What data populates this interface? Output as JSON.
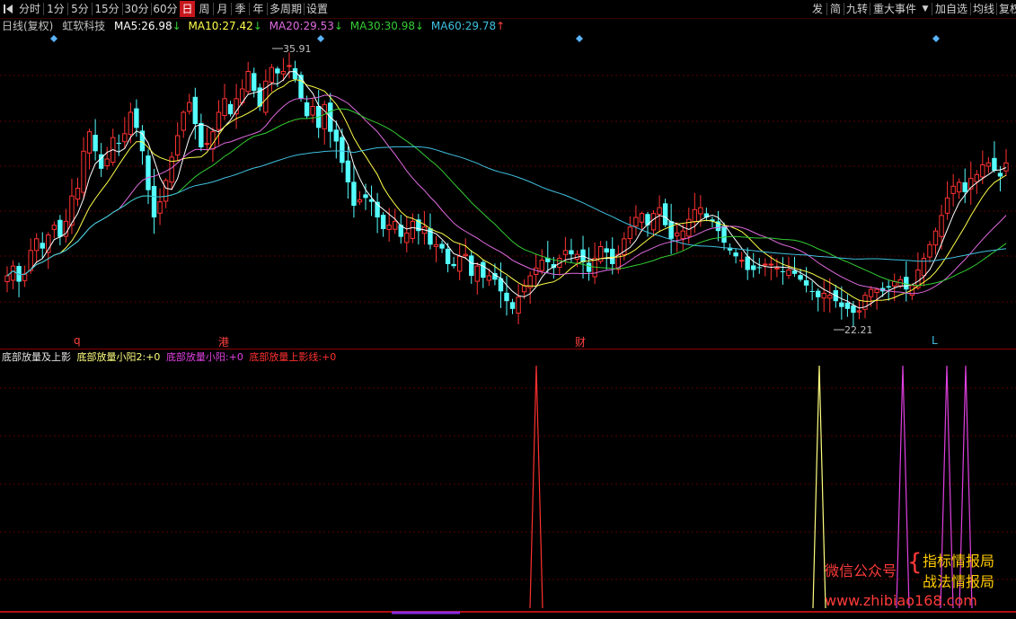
{
  "toolbar": {
    "left_icon": "play-left-icon",
    "periods": [
      "分时",
      "1分",
      "5分",
      "15分",
      "30分",
      "60分",
      "日",
      "周",
      "月",
      "季",
      "年",
      "多周期",
      "设置"
    ],
    "active_period": "日",
    "right_buttons": [
      "发",
      "简",
      "九转",
      "重大事件",
      "▼",
      "加自选",
      "均线",
      "复权"
    ]
  },
  "info": {
    "period_label": "日线(复权)",
    "stock_name": "虹软科技",
    "ma5": {
      "label": "MA5:",
      "value": "26.98",
      "arrow": "↓",
      "color": "#ffffff"
    },
    "ma10": {
      "label": "MA10:",
      "value": "27.42",
      "arrow": "↓",
      "color": "#ffff4a"
    },
    "ma20": {
      "label": "MA20:",
      "value": "29.53",
      "arrow": "↓",
      "color": "#e06ae0"
    },
    "ma30": {
      "label": "MA30:",
      "value": "30.98",
      "arrow": "↓",
      "color": "#33cc33"
    },
    "ma60": {
      "label": "MA60:",
      "value": "29.78",
      "arrow": "↑",
      "color": "#40c0e0"
    }
  },
  "price_labels": {
    "high": "35.91",
    "low": "22.21"
  },
  "events": {
    "e1": "q",
    "e2": "港",
    "e3": "财",
    "e4": "L"
  },
  "indicator": {
    "title": "底部放量及上影",
    "s1": {
      "name": "底部放量小阳2:",
      "value": "+0",
      "color": "#ffff80"
    },
    "s2": {
      "name": "底部放量小阳:",
      "value": "+0",
      "color": "#e040e0"
    },
    "s3": {
      "name": "底部放量上影线:",
      "value": "+0",
      "color": "#ff3030"
    }
  },
  "watermark": {
    "l1": "微信公众号",
    "brace": "{",
    "r1": "指标情报局",
    "r2": "战法情报局",
    "url": "www.zhibiao168.com"
  },
  "colors": {
    "up": "#ff3232",
    "down": "#54ffff",
    "grid": "#5a0000"
  },
  "chart_data": {
    "type": "candlestick",
    "closes": [
      24.5,
      25.0,
      24.2,
      24.6,
      25.8,
      26.4,
      25.9,
      26.6,
      27.1,
      26.5,
      27.3,
      28.6,
      29.0,
      30.9,
      31.9,
      30.9,
      30.0,
      30.5,
      31.6,
      31.3,
      31.8,
      32.9,
      32.1,
      30.9,
      28.9,
      27.5,
      28.3,
      29.4,
      30.6,
      31.7,
      32.9,
      33.4,
      32.3,
      31.1,
      31.3,
      31.9,
      32.9,
      33.6,
      32.8,
      33.6,
      34.1,
      35.0,
      34.0,
      33.2,
      34.5,
      35.2,
      34.9,
      35.0,
      35.3,
      34.6,
      33.6,
      32.7,
      33.2,
      32.1,
      33.3,
      31.9,
      31.4,
      30.3,
      29.3,
      28.1,
      28.4,
      28.5,
      28.3,
      27.5,
      26.9,
      27.1,
      27.3,
      26.5,
      26.7,
      27.3,
      26.8,
      27.0,
      26.1,
      26.1,
      25.9,
      25.1,
      25.0,
      25.5,
      25.6,
      24.5,
      25.0,
      24.4,
      24.5,
      24.3,
      23.7,
      23.2,
      22.8,
      23.4,
      24.0,
      24.5,
      24.9,
      25.3,
      25.2,
      24.9,
      25.4,
      25.8,
      25.6,
      25.6,
      25.2,
      24.7,
      25.4,
      26.0,
      25.7,
      25.1,
      25.6,
      26.4,
      27.0,
      27.5,
      27.7,
      27.1,
      27.7,
      28.0,
      27.1,
      26.4,
      26.7,
      26.8,
      27.4,
      27.9,
      28.0,
      27.5,
      27.3,
      26.8,
      26.2,
      25.8,
      25.5,
      25.3,
      24.8,
      24.8,
      24.9,
      25.1,
      25.1,
      24.9,
      24.7,
      24.8,
      24.6,
      24.3,
      24.0,
      23.7,
      23.4,
      23.6,
      23.5,
      23.2,
      22.9,
      22.8,
      22.6,
      22.7,
      23.5,
      23.8,
      23.8,
      23.7,
      23.9,
      24.2,
      24.3,
      23.8,
      24.0,
      24.8,
      25.4,
      26.1,
      26.8,
      27.6,
      28.5,
      29.1,
      29.3,
      28.8,
      29.5,
      29.7,
      30.2,
      30.3,
      29.9,
      29.6,
      30.3
    ]
  }
}
